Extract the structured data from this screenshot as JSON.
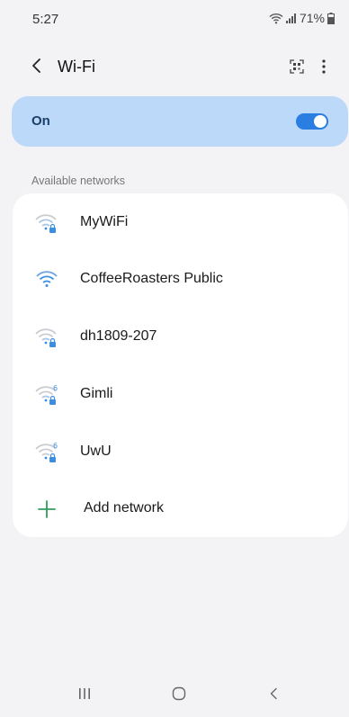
{
  "status_bar": {
    "time": "5:27",
    "battery": "71%",
    "icons": [
      "wifi-signal-icon",
      "cell-signal-icon",
      "battery-icon"
    ]
  },
  "header": {
    "title": "Wi-Fi",
    "icons": [
      "back-arrow-icon",
      "qr-scan-icon",
      "more-vert-icon"
    ]
  },
  "wifi_toggle": {
    "label": "On",
    "state": true,
    "accent_color": "#2a7de1",
    "background_color": "#bcd9f9"
  },
  "available_networks": {
    "header": "Available networks",
    "networks": [
      {
        "name": "MyWiFi",
        "secured": true,
        "wifi6": false
      },
      {
        "name": "CoffeeRoasters Public",
        "secured": false,
        "wifi6": false
      },
      {
        "name": "dh1809-207",
        "secured": true,
        "wifi6": false
      },
      {
        "name": "Gimli",
        "secured": true,
        "wifi6": true
      },
      {
        "name": "UwU",
        "secured": true,
        "wifi6": true
      }
    ],
    "add_network_label": "Add network"
  },
  "nav_bar": {
    "icons": [
      "recents-icon",
      "home-icon",
      "back-icon"
    ]
  }
}
